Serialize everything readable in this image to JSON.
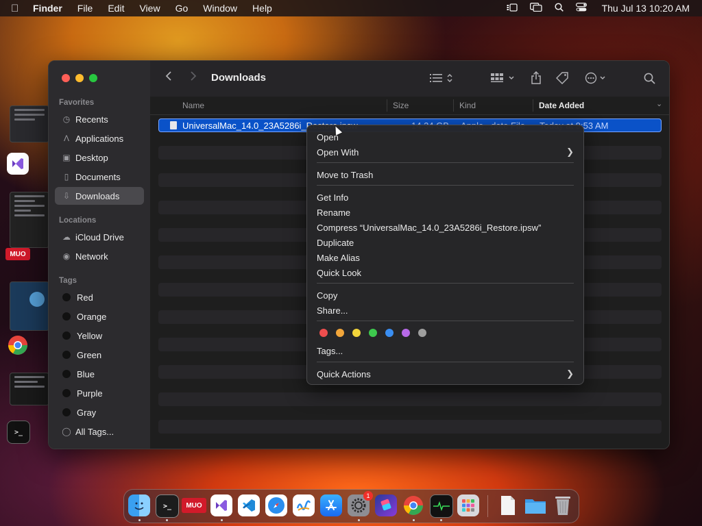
{
  "menubar": {
    "app_name": "Finder",
    "menus": [
      "File",
      "Edit",
      "View",
      "Go",
      "Window",
      "Help"
    ],
    "clock": "Thu Jul 13  10:20 AM"
  },
  "stage_labels": {
    "muo": "MUO"
  },
  "window": {
    "title": "Downloads",
    "sidebar": {
      "favorites_heading": "Favorites",
      "favorites": [
        {
          "label": "Recents",
          "icon": "clock-icon"
        },
        {
          "label": "Applications",
          "icon": "applications-icon"
        },
        {
          "label": "Desktop",
          "icon": "desktop-icon"
        },
        {
          "label": "Documents",
          "icon": "document-icon"
        },
        {
          "label": "Downloads",
          "icon": "download-icon",
          "active": true
        }
      ],
      "locations_heading": "Locations",
      "locations": [
        {
          "label": "iCloud Drive",
          "icon": "cloud-icon"
        },
        {
          "label": "Network",
          "icon": "globe-icon"
        }
      ],
      "tags_heading": "Tags",
      "tags": [
        "Red",
        "Orange",
        "Yellow",
        "Green",
        "Blue",
        "Purple",
        "Gray"
      ],
      "all_tags": "All Tags..."
    },
    "columns": {
      "name": "Name",
      "size": "Size",
      "kind": "Kind",
      "date_added": "Date Added"
    },
    "selected_file": {
      "name": "UniversalMac_14.0_23A5286i_Restore.ipsw",
      "size": "14.34 GB",
      "kind": "Apple...date File",
      "date": "Today at 9:53 AM"
    }
  },
  "context_menu": {
    "open": "Open",
    "open_with": "Open With",
    "move_to_trash": "Move to Trash",
    "get_info": "Get Info",
    "rename": "Rename",
    "compress": "Compress “UniversalMac_14.0_23A5286i_Restore.ipsw”",
    "duplicate": "Duplicate",
    "make_alias": "Make Alias",
    "quick_look": "Quick Look",
    "copy": "Copy",
    "share": "Share...",
    "tags": "Tags...",
    "quick_actions": "Quick Actions",
    "tag_colors": [
      "#ee4e4e",
      "#f2a63a",
      "#f2d43a",
      "#3ec94e",
      "#3a8ef2",
      "#b86ae8",
      "#9e9e9e"
    ]
  },
  "dock": {
    "muo_label": "MUO",
    "badge_count": "1",
    "apps": [
      "finder-icon",
      "terminal-icon",
      "muo-icon",
      "visual-studio-icon",
      "vscode-icon",
      "safari-icon",
      "freeform-icon",
      "app-store-icon",
      "system-settings-icon",
      "shortcuts-icon",
      "chrome-icon",
      "activity-monitor-icon",
      "launchpad-icon",
      "document-icon",
      "downloads-folder-icon",
      "trash-icon"
    ]
  }
}
